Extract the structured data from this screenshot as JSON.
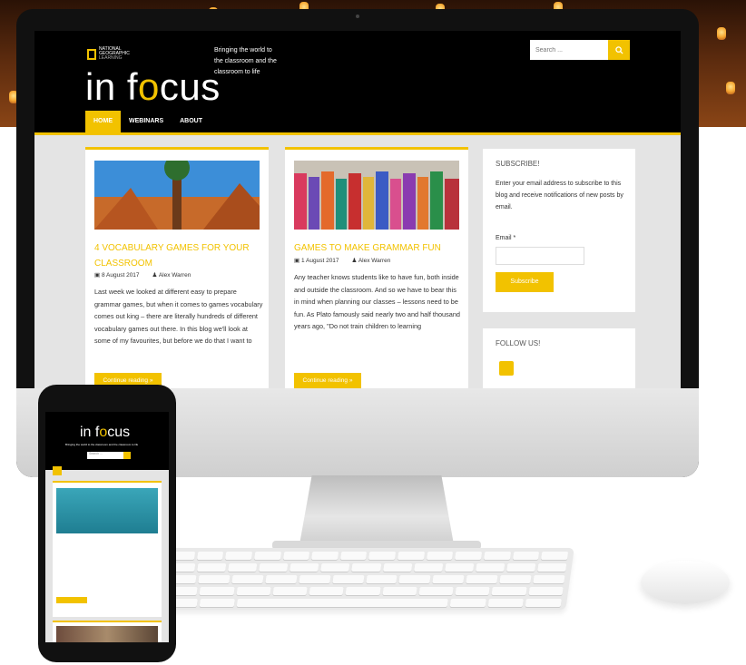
{
  "header": {
    "brand_line1": "NATIONAL",
    "brand_line2": "GEOGRAPHIC",
    "brand_line3": "LEARNING",
    "site_title_pre": "in f",
    "site_title_o": "o",
    "site_title_post": "cus",
    "tagline": "Bringing the world to the classroom and the classroom to life"
  },
  "search": {
    "placeholder": "Search ..."
  },
  "nav": {
    "items": [
      {
        "label": "HOME"
      },
      {
        "label": "WEBINARS"
      },
      {
        "label": "ABOUT"
      }
    ]
  },
  "posts": [
    {
      "title": "4 VOCABULARY GAMES FOR YOUR CLASSROOM",
      "date": "8 August 2017",
      "author": "Alex Warren",
      "excerpt": "Last week we looked at different easy to prepare grammar games, but when it comes to games vocabulary comes out king – there are literally hundreds of different vocabulary games out there. In this blog we'll look at some of my favourites, but before we do that I want to",
      "continue": "Continue reading »"
    },
    {
      "title": "GAMES TO MAKE GRAMMAR FUN",
      "date": "1 August 2017",
      "author": "Alex Warren",
      "excerpt": "Any teacher knows students like to have fun, both inside and outside the classroom. And so we have to bear this in mind when planning our classes – lessons need to be fun. As Plato famously said nearly two and half thousand years ago, \"Do not train children to learning",
      "continue": "Continue reading »"
    }
  ],
  "subscribe": {
    "title": "SUBSCRIBE!",
    "text": "Enter your email address to subscribe to this blog and receive notifications of new posts by email.",
    "email_label": "Email *",
    "button": "Subscribe"
  },
  "follow": {
    "title": "FOLLOW US!"
  },
  "colors": {
    "accent": "#f2c200",
    "header_bg": "#000000",
    "page_bg": "#e4e4e4"
  }
}
